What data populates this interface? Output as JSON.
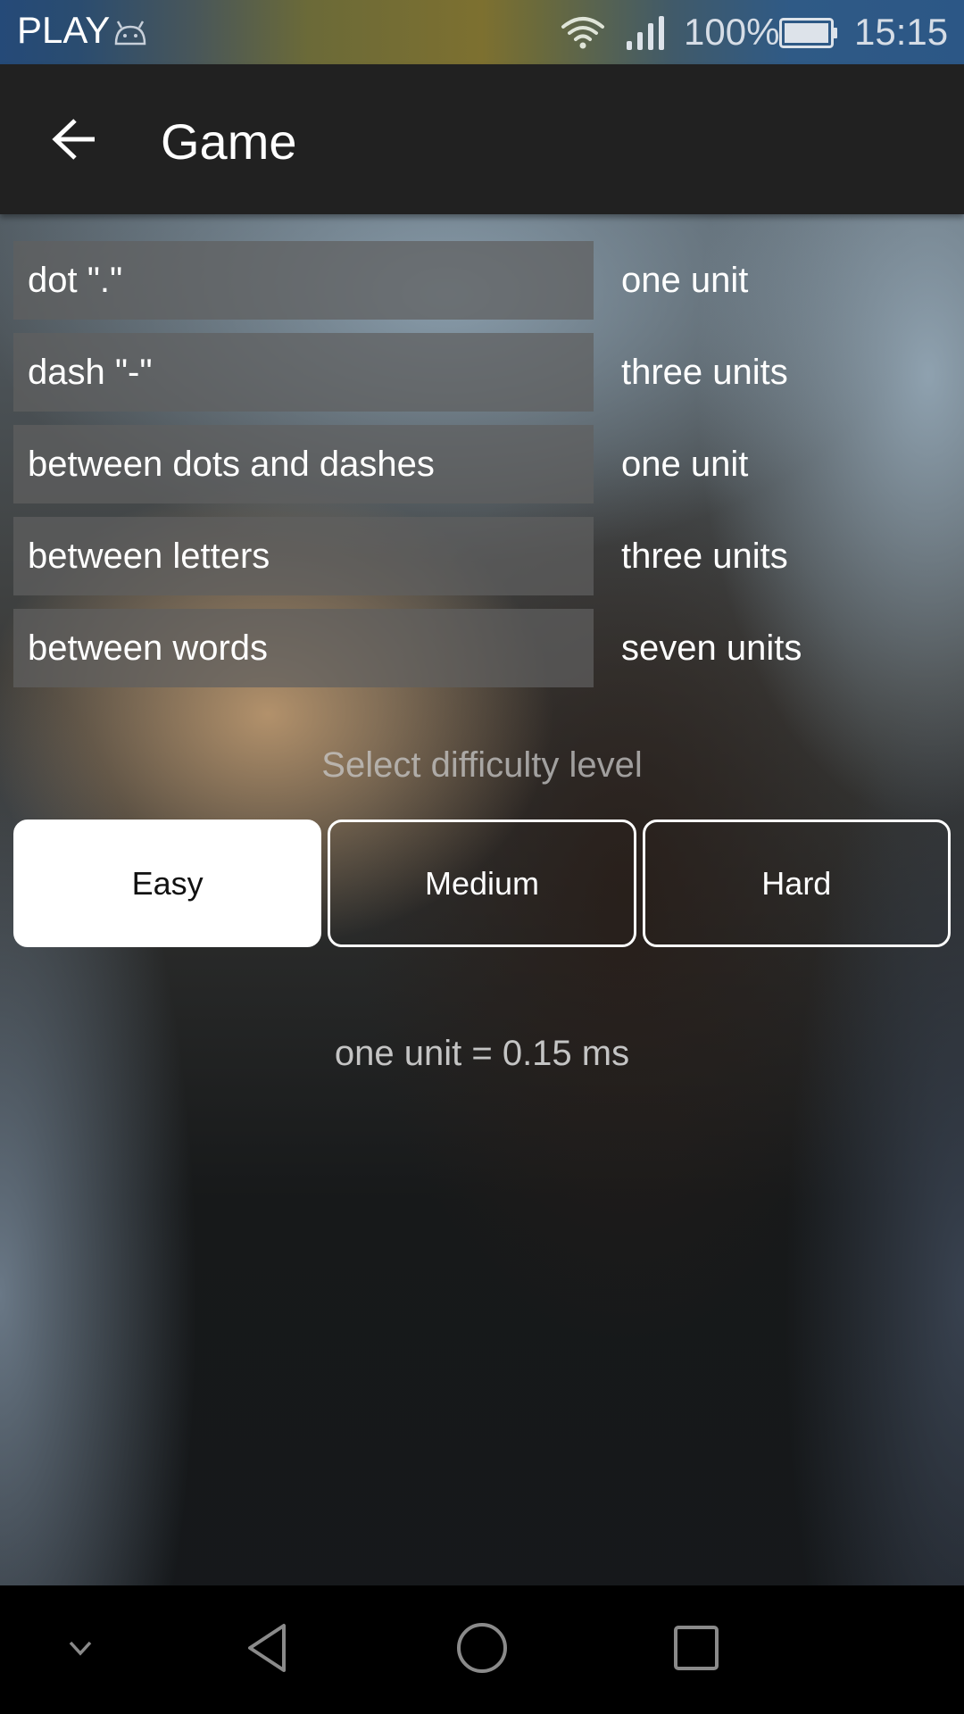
{
  "status_bar": {
    "carrier": "PLAY",
    "battery_percent": "100%",
    "time": "15:15",
    "icons": [
      "android-icon",
      "wifi-icon",
      "signal-icon",
      "battery-icon"
    ]
  },
  "app_bar": {
    "title": "Game",
    "back_icon": "arrow-left-icon"
  },
  "unit_table": [
    {
      "name": "dot \".\"",
      "value": "one unit"
    },
    {
      "name": "dash \"-\"",
      "value": "three units"
    },
    {
      "name": "between dots and dashes",
      "value": "one unit"
    },
    {
      "name": "between letters",
      "value": "three units"
    },
    {
      "name": "between words",
      "value": "seven units"
    }
  ],
  "difficulty": {
    "label": "Select difficulty level",
    "options": [
      "Easy",
      "Medium",
      "Hard"
    ],
    "selected": "Easy"
  },
  "unit_info": "one unit = 0.15 ms",
  "nav_bar": {
    "icons": [
      "chevron-down-icon",
      "back-triangle-icon",
      "home-circle-icon",
      "recents-square-icon"
    ]
  }
}
